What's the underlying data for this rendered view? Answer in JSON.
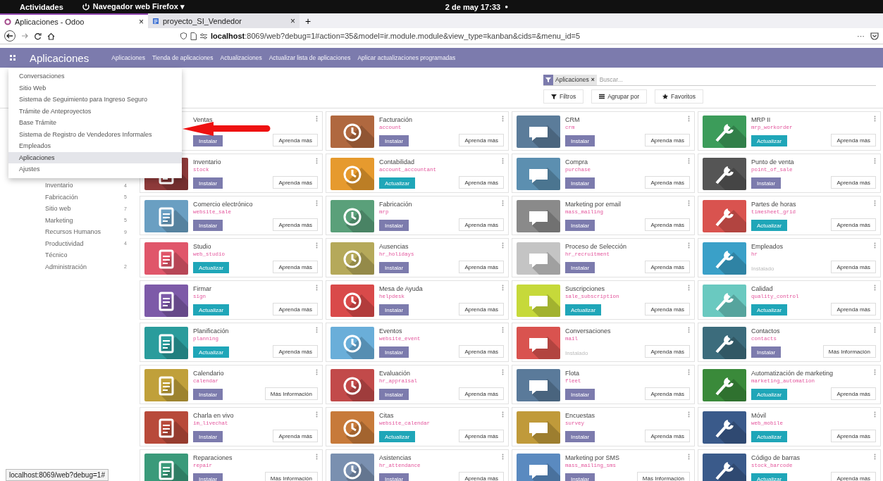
{
  "top_bar": {
    "activities": "Actividades",
    "app_menu": "Navegador web Firefox ▾",
    "clock": "2 de may 17:33",
    "indicator": "●"
  },
  "browser": {
    "tabs": [
      {
        "title": "Aplicaciones - Odoo",
        "selected": true,
        "close": "×"
      },
      {
        "title": "proyecto_SI_Vendedor",
        "selected": false,
        "close": "×"
      }
    ],
    "new_tab": "+",
    "url": "**localhost**:8069/web?debug=1#action=35&model=ir.module.module&view_type=kanban&cids=&menu_id=5",
    "page_actions": "···"
  },
  "navbar": {
    "title": "Aplicaciones",
    "menu": [
      "Aplicaciones",
      "Tienda de aplicaciones",
      "Actualizaciones",
      "Actualizar lista de aplicaciones",
      "Aplicar actualizaciones programadas"
    ]
  },
  "apps_menu": {
    "items": [
      {
        "label": "Conversaciones",
        "selected": false
      },
      {
        "label": "Sitio Web",
        "selected": false
      },
      {
        "label": "Sistema de Seguimiento para Ingreso Seguro",
        "selected": false
      },
      {
        "label": "Trámite de Anteproyectos",
        "selected": false
      },
      {
        "label": "Base Trámite",
        "selected": false
      },
      {
        "label": "Sistema de Registro de Vendedores Informales",
        "selected": false
      },
      {
        "label": "Empleados",
        "selected": false
      },
      {
        "label": "Aplicaciones",
        "selected": true
      },
      {
        "label": "Ajustes",
        "selected": false
      }
    ]
  },
  "search": {
    "facet": "Aplicaciones",
    "facet_remove": "×",
    "placeholder": "Buscar...",
    "buttons": [
      {
        "kind": "filter",
        "label": "Filtros"
      },
      {
        "kind": "group",
        "label": "Agrupar por"
      },
      {
        "kind": "favorite",
        "label": "Favoritos"
      }
    ]
  },
  "categories": [
    {
      "label": "Inventario",
      "count": "4"
    },
    {
      "label": "Fabricación",
      "count": "5"
    },
    {
      "label": "Sitio web",
      "count": "7"
    },
    {
      "label": "Marketing",
      "count": "5"
    },
    {
      "label": "Recursos Humanos",
      "count": "9"
    },
    {
      "label": "Productividad",
      "count": "4"
    },
    {
      "label": "Técnico"
    },
    {
      "label": "Administración",
      "count": "2"
    }
  ],
  "apps": [
    {
      "title": "Ventas",
      "action": {
        "kind": "install",
        "label": "Instalar"
      },
      "info": "Aprenda más"
    },
    {
      "title": "Facturación",
      "module": "account",
      "color": "#b0683f",
      "action": {
        "kind": "install",
        "label": "Instalar"
      },
      "info": "Aprenda más"
    },
    {
      "title": "CRM",
      "module": "crm",
      "color": "#5b7c9a",
      "action": {
        "kind": "install",
        "label": "Instalar"
      },
      "info": "Aprenda más"
    },
    {
      "title": "MRP II",
      "module": "mrp_workorder",
      "color": "#3c9c5a",
      "action": {
        "kind": "upgrade",
        "label": "Actualizar"
      },
      "info": "Aprenda más"
    },
    {
      "title": "Inventario",
      "module": "stock",
      "color": "#8e3a3a",
      "action": {
        "kind": "install",
        "label": "Instalar"
      },
      "info": "Aprenda más"
    },
    {
      "title": "Contabilidad",
      "module": "account_accountant",
      "color": "#e69a2e",
      "action": {
        "kind": "upgrade",
        "label": "Actualizar"
      },
      "info": "Aprenda más"
    },
    {
      "title": "Compra",
      "module": "purchase",
      "color": "#5c8fb0",
      "action": {
        "kind": "install",
        "label": "Instalar"
      },
      "info": "Aprenda más"
    },
    {
      "title": "Punto de venta",
      "module": "point_of_sale",
      "color": "#555555",
      "action": {
        "kind": "install",
        "label": "Instalar"
      },
      "info": "Aprenda más"
    },
    {
      "title": "Comercio electrónico",
      "module": "website_sale",
      "color": "#6a9fc2",
      "action": {
        "kind": "install",
        "label": "Instalar"
      },
      "info": "Aprenda más"
    },
    {
      "title": "Fabricación",
      "module": "mrp",
      "color": "#5aa07a",
      "action": {
        "kind": "install",
        "label": "Instalar"
      },
      "info": "Aprenda más"
    },
    {
      "title": "Marketing por email",
      "module": "mass_mailing",
      "color": "#8a8a8a",
      "action": {
        "kind": "install",
        "label": "Instalar"
      },
      "info": "Aprenda más"
    },
    {
      "title": "Partes de horas",
      "module": "timesheet_grid",
      "color": "#d9534f",
      "action": {
        "kind": "upgrade",
        "label": "Actualizar"
      },
      "info": "Aprenda más"
    },
    {
      "title": "Studio",
      "module": "web_studio",
      "color": "#e0566a",
      "action": {
        "kind": "upgrade",
        "label": "Actualizar"
      },
      "info": "Aprenda más"
    },
    {
      "title": "Ausencias",
      "module": "hr_holidays",
      "color": "#b5a95a",
      "action": {
        "kind": "install",
        "label": "Instalar"
      },
      "info": "Aprenda más"
    },
    {
      "title": "Proceso de Selección",
      "module": "hr_recruitment",
      "color": "#c4c4c4",
      "action": {
        "kind": "install",
        "label": "Instalar"
      },
      "info": "Aprenda más"
    },
    {
      "title": "Empleados",
      "module": "hr",
      "color": "#3aa0c8",
      "action": {
        "kind": "installed",
        "label": "Instalado"
      },
      "info": "Aprenda más"
    },
    {
      "title": "Firmar",
      "module": "sign",
      "color": "#7d5aa8",
      "action": {
        "kind": "upgrade",
        "label": "Actualizar"
      },
      "info": "Aprenda más"
    },
    {
      "title": "Mesa de Ayuda",
      "module": "helpdesk",
      "color": "#d94a4a",
      "action": {
        "kind": "install",
        "label": "Instalar"
      },
      "info": "Aprenda más"
    },
    {
      "title": "Suscripciones",
      "module": "sale_subscription",
      "color": "#c6d93a",
      "action": {
        "kind": "upgrade",
        "label": "Actualizar"
      },
      "info": "Aprenda más"
    },
    {
      "title": "Calidad",
      "module": "quality_control",
      "color": "#6ac9c0",
      "action": {
        "kind": "upgrade",
        "label": "Actualizar"
      },
      "info": "Aprenda más"
    },
    {
      "title": "Planificación",
      "module": "planning",
      "color": "#2a9c9c",
      "action": {
        "kind": "upgrade",
        "label": "Actualizar"
      },
      "info": "Aprenda más"
    },
    {
      "title": "Eventos",
      "module": "website_event",
      "color": "#6aaed9",
      "action": {
        "kind": "install",
        "label": "Instalar"
      },
      "info": "Aprenda más"
    },
    {
      "title": "Conversaciones",
      "module": "mail",
      "color": "#d9534f",
      "action": {
        "kind": "installed",
        "label": "Instalado"
      },
      "info": "Aprenda más"
    },
    {
      "title": "Contactos",
      "module": "contacts",
      "color": "#3c6c7c",
      "action": {
        "kind": "install",
        "label": "Instalar"
      },
      "info": "Más Información"
    },
    {
      "title": "Calendario",
      "module": "calendar",
      "color": "#c0a03a",
      "action": {
        "kind": "install",
        "label": "Instalar"
      },
      "info": "Más Información"
    },
    {
      "title": "Evaluación",
      "module": "hr_appraisal",
      "color": "#c24a4a",
      "action": {
        "kind": "install",
        "label": "Instalar"
      },
      "info": "Aprenda más"
    },
    {
      "title": "Flota",
      "module": "fleet",
      "color": "#5a7a9a",
      "action": {
        "kind": "install",
        "label": "Instalar"
      },
      "info": "Aprenda más"
    },
    {
      "title": "Automatización de marketing",
      "module": "marketing_automation",
      "color": "#3a8a3a",
      "action": {
        "kind": "upgrade",
        "label": "Actualizar"
      },
      "info": "Aprenda más"
    },
    {
      "title": "Charla en vivo",
      "module": "im_livechat",
      "color": "#b84a3a",
      "action": {
        "kind": "install",
        "label": "Instalar"
      },
      "info": "Aprenda más"
    },
    {
      "title": "Citas",
      "module": "website_calendar",
      "color": "#c77a3a",
      "action": {
        "kind": "upgrade",
        "label": "Actualizar"
      },
      "info": "Aprenda más"
    },
    {
      "title": "Encuestas",
      "module": "survey",
      "color": "#c09a3a",
      "action": {
        "kind": "install",
        "label": "Instalar"
      },
      "info": "Aprenda más"
    },
    {
      "title": "Móvil",
      "module": "web_mobile",
      "color": "#3a5a8a",
      "action": {
        "kind": "upgrade",
        "label": "Actualizar"
      },
      "info": "Aprenda más"
    },
    {
      "title": "Reparaciones",
      "module": "repair",
      "color": "#3a9a7a",
      "action": {
        "kind": "install",
        "label": "Instalar"
      },
      "info": "Más Información"
    },
    {
      "title": "Asistencias",
      "module": "hr_attendance",
      "color": "#7a90b0",
      "action": {
        "kind": "install",
        "label": "Instalar"
      },
      "info": "Aprenda más"
    },
    {
      "title": "Marketing por SMS",
      "module": "mass_mailing_sms",
      "color": "#5a8ac0",
      "action": {
        "kind": "install",
        "label": "Instalar"
      },
      "info": "Más Información"
    },
    {
      "title": "Código de barras",
      "module": "stock_barcode",
      "color": "#3a5a8a",
      "action": {
        "kind": "upgrade",
        "label": "Actualizar"
      },
      "info": "Aprenda más"
    }
  ],
  "status_url": "localhost:8069/web?debug=1#"
}
